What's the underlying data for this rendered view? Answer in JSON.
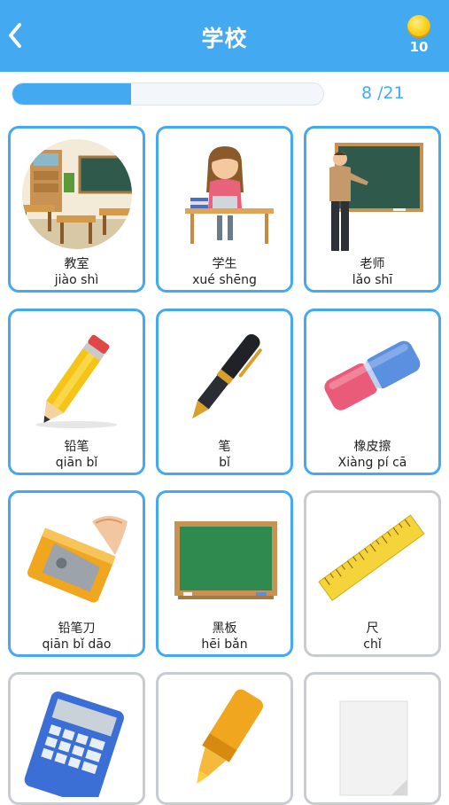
{
  "header": {
    "title": "学校",
    "back_icon": "chevron-left-icon",
    "coin_icon": "gold-coin-icon",
    "coins": "10"
  },
  "progress": {
    "current": 8,
    "total": 21,
    "label": "8 /21"
  },
  "colors": {
    "accent": "#43a9f0",
    "inactive_border": "#c8ccd2"
  },
  "cards": [
    {
      "hanzi": "教室",
      "pinyin": "jiào shì",
      "image": "classroom"
    },
    {
      "hanzi": "学生",
      "pinyin": "xué shēng",
      "image": "student"
    },
    {
      "hanzi": "老师",
      "pinyin": "lǎo shī",
      "image": "teacher"
    },
    {
      "hanzi": "铅笔",
      "pinyin": "qiān bǐ",
      "image": "pencil"
    },
    {
      "hanzi": "笔",
      "pinyin": "bǐ",
      "image": "pen"
    },
    {
      "hanzi": "橡皮擦",
      "pinyin": "Xiàng pí cā",
      "image": "eraser"
    },
    {
      "hanzi": "铅笔刀",
      "pinyin": "qiān bǐ dāo",
      "image": "pencil-sharpener"
    },
    {
      "hanzi": "黑板",
      "pinyin": "hēi bǎn",
      "image": "blackboard"
    },
    {
      "hanzi": "尺",
      "pinyin": "chǐ",
      "image": "ruler"
    },
    {
      "image": "calculator"
    },
    {
      "image": "highlighter"
    },
    {
      "image": "paper"
    }
  ]
}
